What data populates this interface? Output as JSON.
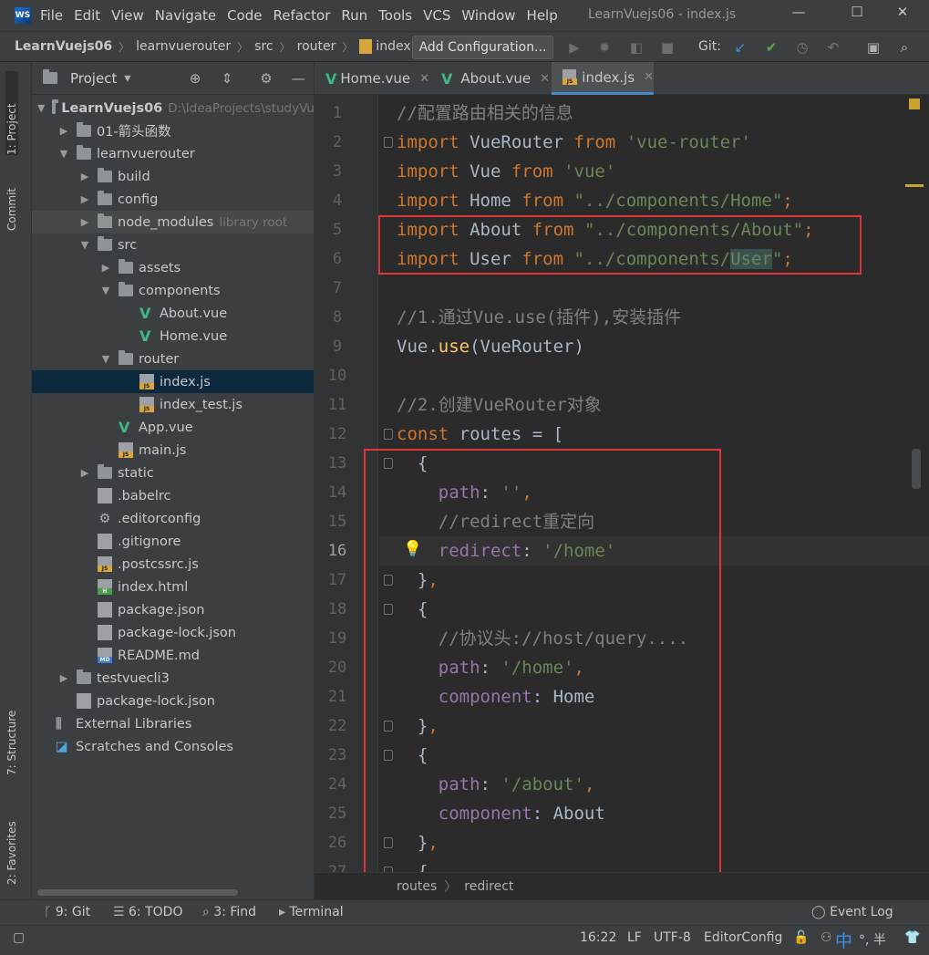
{
  "window": {
    "title": "LearnVuejs06 - index.js",
    "menu": [
      "File",
      "Edit",
      "View",
      "Navigate",
      "Code",
      "Refactor",
      "Run",
      "Tools",
      "VCS",
      "Window",
      "Help"
    ],
    "controls": {
      "minimize": "—",
      "maximize": "☐",
      "close": "✕"
    }
  },
  "navbar": {
    "breadcrumbs": [
      "LearnVuejs06",
      "learnvuerouter",
      "src",
      "router",
      "index.js"
    ],
    "add_configuration": "Add Configuration...",
    "git_label": "Git:"
  },
  "left_strip": {
    "tabs": [
      "1: Project",
      "Commit",
      "7: Structure",
      "2: Favorites"
    ]
  },
  "project_panel": {
    "title": "Project",
    "tree": [
      {
        "label": "LearnVuejs06",
        "extra": "D:\\IdeaProjects\\studyVu",
        "type": "root",
        "depth": 0,
        "arrow": "down"
      },
      {
        "label": "01-箭头函数",
        "type": "folder",
        "depth": 1,
        "arrow": "right"
      },
      {
        "label": "learnvuerouter",
        "type": "folder",
        "depth": 1,
        "arrow": "down"
      },
      {
        "label": "build",
        "type": "folder",
        "depth": 2,
        "arrow": "right"
      },
      {
        "label": "config",
        "type": "folder",
        "depth": 2,
        "arrow": "right"
      },
      {
        "label": "node_modules",
        "extra": "library root",
        "type": "folder",
        "depth": 2,
        "arrow": "right",
        "hl": true
      },
      {
        "label": "src",
        "type": "folder",
        "depth": 2,
        "arrow": "down"
      },
      {
        "label": "assets",
        "type": "folder",
        "depth": 3,
        "arrow": "right"
      },
      {
        "label": "components",
        "type": "folder",
        "depth": 3,
        "arrow": "down"
      },
      {
        "label": "About.vue",
        "type": "vue",
        "depth": 4
      },
      {
        "label": "Home.vue",
        "type": "vue",
        "depth": 4
      },
      {
        "label": "router",
        "type": "folder",
        "depth": 3,
        "arrow": "down"
      },
      {
        "label": "index.js",
        "type": "js",
        "depth": 4,
        "selected": true
      },
      {
        "label": "index_test.js",
        "type": "js",
        "depth": 4
      },
      {
        "label": "App.vue",
        "type": "vue",
        "depth": 3
      },
      {
        "label": "main.js",
        "type": "js",
        "depth": 3
      },
      {
        "label": "static",
        "type": "folder",
        "depth": 2,
        "arrow": "right"
      },
      {
        "label": ".babelrc",
        "type": "cfg",
        "depth": 2
      },
      {
        "label": ".editorconfig",
        "type": "gear",
        "depth": 2
      },
      {
        "label": ".gitignore",
        "type": "cfg",
        "depth": 2
      },
      {
        "label": ".postcssrc.js",
        "type": "js",
        "depth": 2
      },
      {
        "label": "index.html",
        "type": "html",
        "depth": 2
      },
      {
        "label": "package.json",
        "type": "cfg",
        "depth": 2
      },
      {
        "label": "package-lock.json",
        "type": "cfg",
        "depth": 2
      },
      {
        "label": "README.md",
        "type": "md",
        "depth": 2
      },
      {
        "label": "testvuecli3",
        "type": "folder",
        "depth": 1,
        "arrow": "right"
      },
      {
        "label": "package-lock.json",
        "type": "cfg",
        "depth": 1
      },
      {
        "label": "External Libraries",
        "type": "lib",
        "depth": 0
      },
      {
        "label": "Scratches and Consoles",
        "type": "scratch",
        "depth": 0
      }
    ]
  },
  "editor": {
    "tabs": [
      {
        "label": "Home.vue",
        "type": "vue"
      },
      {
        "label": "About.vue",
        "type": "vue"
      },
      {
        "label": "index.js",
        "type": "js",
        "active": true
      }
    ],
    "current_line": 16,
    "lines": [
      "//配置路由相关的信息",
      "import VueRouter from 'vue-router'",
      "import Vue from 'vue'",
      "import Home from \"../components/Home\";",
      "import About from \"../components/About\";",
      "import User from \"../components/User\";",
      "",
      "//1.通过Vue.use(插件),安装插件",
      "Vue.use(VueRouter)",
      "",
      "//2.创建VueRouter对象",
      "const routes = [",
      "  {",
      "    path: '',",
      "    //redirect重定向",
      "    redirect: '/home'",
      "  },",
      "  {",
      "    //协议头://host/query....",
      "    path: '/home',",
      "    component: Home",
      "  },",
      "  {",
      "    path: '/about',",
      "    component: About",
      "  },",
      "  {"
    ],
    "breadcrumb": [
      "routes",
      "redirect"
    ]
  },
  "bottom_toolbar": {
    "items": [
      "9: Git",
      "6: TODO",
      "3: Find",
      "Terminal"
    ],
    "event_log": "Event Log"
  },
  "status_bar": {
    "position": "16:22",
    "line_sep": "LF",
    "encoding": "UTF-8",
    "editor_config": "EditorConfig",
    "ime": "中",
    "ime_extra": "°, 半"
  },
  "colors": {
    "keyword": "#cc7832",
    "string": "#6a8759",
    "comment": "#808080",
    "property": "#9876aa",
    "annotation_box": "#e03535"
  }
}
